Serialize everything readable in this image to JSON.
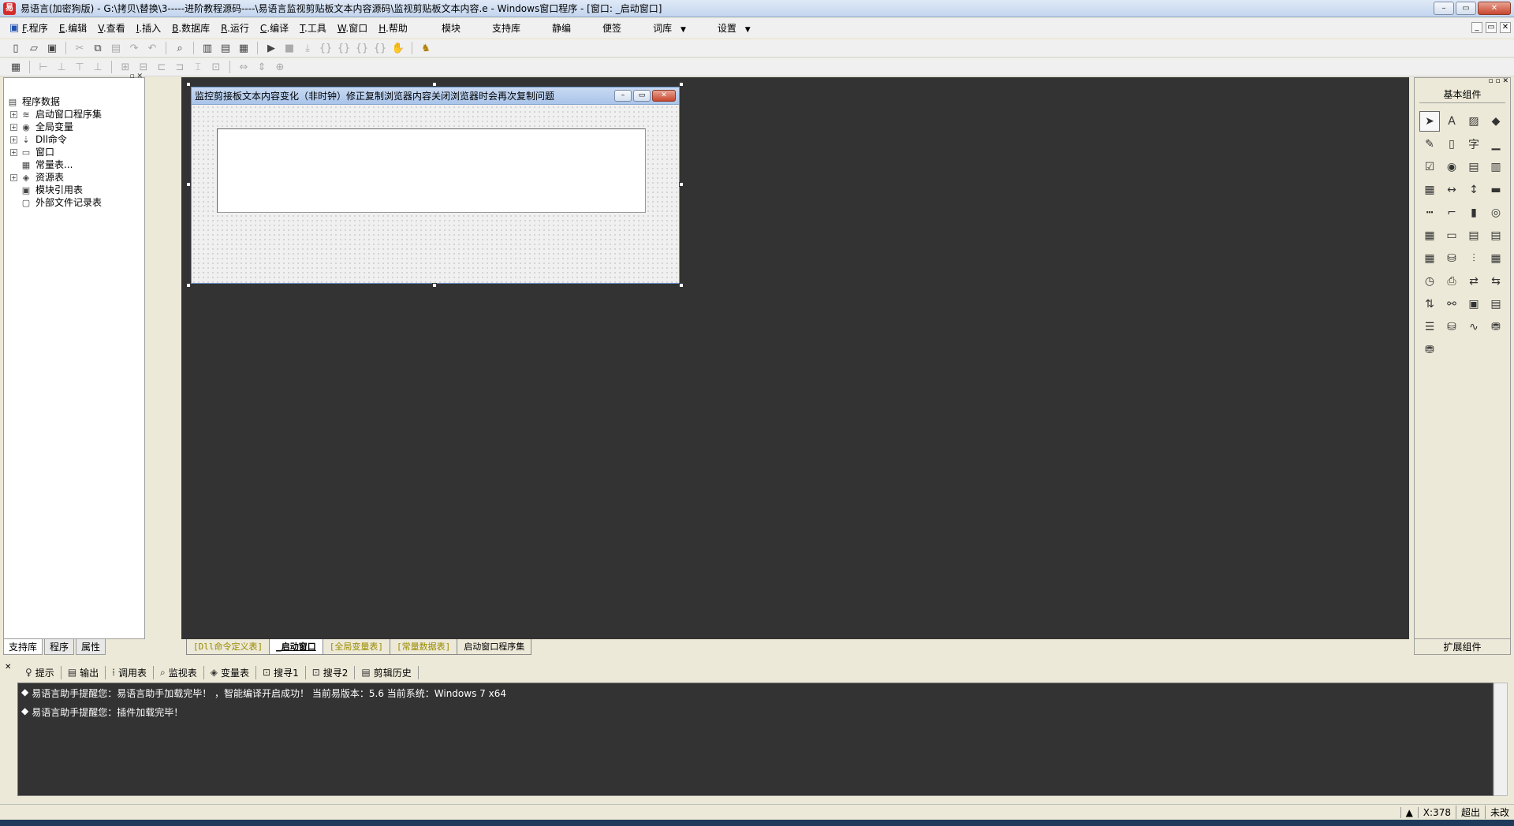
{
  "window": {
    "title": "易语言(加密狗版) - G:\\拷贝\\替换\\3-----进阶教程源码----\\易语言监视剪贴板文本内容源码\\监视剪贴板文本内容.e - Windows窗口程序 - [窗口: _启动窗口]",
    "minimize": "–",
    "maximize": "▭",
    "close": "✕"
  },
  "menu": {
    "items": [
      {
        "key": "F",
        "label": ".程序"
      },
      {
        "key": "E",
        "label": ".编辑"
      },
      {
        "key": "V",
        "label": ".查看"
      },
      {
        "key": "I",
        "label": ".插入"
      },
      {
        "key": "B",
        "label": ".数据库"
      },
      {
        "key": "R",
        "label": ".运行"
      },
      {
        "key": "C",
        "label": ".编译"
      },
      {
        "key": "T",
        "label": ".工具"
      },
      {
        "key": "W",
        "label": ".窗口"
      },
      {
        "key": "H",
        "label": ".帮助"
      }
    ],
    "right_items": [
      "模块",
      "支持库",
      "静编",
      "便签",
      "词库",
      "设置"
    ]
  },
  "left_panel": {
    "tree": [
      {
        "label": "程序数据",
        "level": 0,
        "expander": "",
        "icon": "database-icon",
        "glyph": "▤"
      },
      {
        "label": "启动窗口程序集",
        "level": 1,
        "expander": "+",
        "icon": "stack-icon",
        "glyph": "≋"
      },
      {
        "label": "全局变量",
        "level": 1,
        "expander": "+",
        "icon": "cylinder-icon",
        "glyph": "◉"
      },
      {
        "label": "Dll命令",
        "level": 1,
        "expander": "+",
        "icon": "dll-icon",
        "glyph": "⇣"
      },
      {
        "label": "窗口",
        "level": 1,
        "expander": "+",
        "icon": "window-icon",
        "glyph": "▭"
      },
      {
        "label": "常量表...",
        "level": 1,
        "expander": "",
        "icon": "constant-icon",
        "glyph": "▦"
      },
      {
        "label": "资源表",
        "level": 1,
        "expander": "+",
        "icon": "resource-icon",
        "glyph": "◈"
      },
      {
        "label": "模块引用表",
        "level": 1,
        "expander": "",
        "icon": "module-ref-icon",
        "glyph": "▣"
      },
      {
        "label": "外部文件记录表",
        "level": 1,
        "expander": "",
        "icon": "file-record-icon",
        "glyph": "▢"
      }
    ],
    "tabs": [
      "支持库",
      "程序",
      "属性"
    ]
  },
  "designer": {
    "window_title": "监控剪接板文本内容变化（非时钟）修正复制浏览器内容关闭浏览器时会再次复制问题"
  },
  "work_tabs": [
    {
      "label": "[Dll命令定义表]",
      "style": "olive"
    },
    {
      "label": "_启动窗口",
      "style": "active"
    },
    {
      "label": "[全局变量表]",
      "style": "olive"
    },
    {
      "label": "[常量数据表]",
      "style": "olive"
    },
    {
      "label": "启动窗口程序集",
      "style": "normal"
    }
  ],
  "right_panel": {
    "title": "基本组件",
    "footer": "扩展组件",
    "components": [
      {
        "name": "pointer-icon",
        "glyph": "➤"
      },
      {
        "name": "label-icon",
        "glyph": "A"
      },
      {
        "name": "picture-box-icon",
        "glyph": "▨"
      },
      {
        "name": "shape-icon",
        "glyph": "◆"
      },
      {
        "name": "drawing-board-icon",
        "glyph": "✎"
      },
      {
        "name": "panel-icon",
        "glyph": "▯"
      },
      {
        "name": "text-icon",
        "glyph": "字"
      },
      {
        "name": "edit-box-icon",
        "glyph": "▁"
      },
      {
        "name": "checkbox-icon",
        "glyph": "☑"
      },
      {
        "name": "radio-icon",
        "glyph": "◉"
      },
      {
        "name": "combo-box-icon",
        "glyph": "▤"
      },
      {
        "name": "list-box-icon",
        "glyph": "▥"
      },
      {
        "name": "select-list-icon",
        "glyph": "▦"
      },
      {
        "name": "horizontal-scroll-icon",
        "glyph": "↔"
      },
      {
        "name": "vertical-scroll-icon",
        "glyph": "↕"
      },
      {
        "name": "progress-icon",
        "glyph": "▬"
      },
      {
        "name": "slider-icon",
        "glyph": "┅"
      },
      {
        "name": "tab-icon",
        "glyph": "⌐"
      },
      {
        "name": "image-button-icon",
        "glyph": "▮"
      },
      {
        "name": "animation-icon",
        "glyph": "◎"
      },
      {
        "name": "calendar-icon",
        "glyph": "▦"
      },
      {
        "name": "date-picker-icon",
        "glyph": "▭"
      },
      {
        "name": "folder-icon",
        "glyph": "▤"
      },
      {
        "name": "document-icon",
        "glyph": "▤"
      },
      {
        "name": "table-icon",
        "glyph": "▦"
      },
      {
        "name": "db-provider-icon",
        "glyph": "⛁"
      },
      {
        "name": "split-icon",
        "glyph": "⫶"
      },
      {
        "name": "grid-icon",
        "glyph": "▦"
      },
      {
        "name": "timer-icon",
        "glyph": "◷"
      },
      {
        "name": "printer-icon",
        "glyph": "⎙"
      },
      {
        "name": "client-icon",
        "glyph": "⇄"
      },
      {
        "name": "server-icon",
        "glyph": "⇆"
      },
      {
        "name": "port-icon",
        "glyph": "⇅"
      },
      {
        "name": "network-icon",
        "glyph": "⚯"
      },
      {
        "name": "frame-icon",
        "glyph": "▣"
      },
      {
        "name": "toolbar-icon",
        "glyph": "▤"
      },
      {
        "name": "db-list-icon",
        "glyph": "☰"
      },
      {
        "name": "db-cylinder-icon",
        "glyph": "⛁"
      },
      {
        "name": "chart-icon",
        "glyph": "∿"
      },
      {
        "name": "odbc-icon",
        "glyph": "⛃"
      },
      {
        "name": "odbc-source-icon",
        "glyph": "⛃"
      }
    ]
  },
  "bottom_tabs": [
    {
      "label": "提示",
      "icon": "bulb-icon",
      "glyph": "♀"
    },
    {
      "label": "输出",
      "icon": "output-icon",
      "glyph": "▤"
    },
    {
      "label": "调用表",
      "icon": "call-table-icon",
      "glyph": "⁞"
    },
    {
      "label": "监视表",
      "icon": "magnifier-icon",
      "glyph": "⌕"
    },
    {
      "label": "变量表",
      "icon": "variable-icon",
      "glyph": "◈"
    },
    {
      "label": "搜寻1",
      "icon": "search1-icon",
      "glyph": "⊡"
    },
    {
      "label": "搜寻2",
      "icon": "search2-icon",
      "glyph": "⊡"
    },
    {
      "label": "剪辑历史",
      "icon": "clip-history-icon",
      "glyph": "▤"
    }
  ],
  "output": {
    "lines": [
      {
        "bullet": "◆",
        "text": "易语言助手提醒您：易语言助手加载完毕！  ，智能编译开启成功！  当前易版本：5.6  当前系统：Windows 7 x64"
      },
      {
        "bullet": "◆",
        "text": "易语言助手提醒您：插件加载完毕！"
      }
    ]
  },
  "status": {
    "coord": "X:378",
    "overwrite": "超出",
    "modified": "未改"
  }
}
